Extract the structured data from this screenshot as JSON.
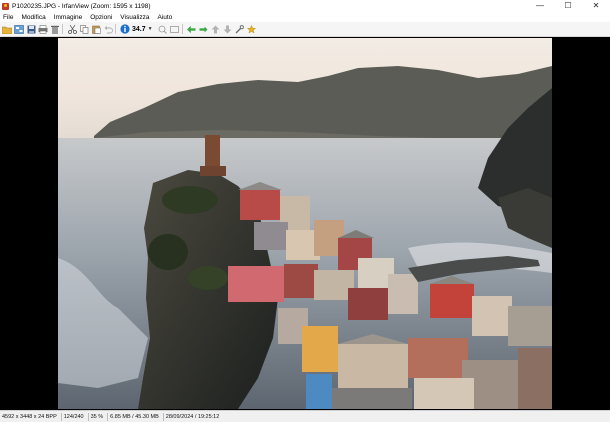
{
  "window": {
    "title": "P1020235.JPG - IrfanView (Zoom: 1595 x 1198)",
    "min_glyph": "—",
    "max_glyph": "☐",
    "close_glyph": "✕"
  },
  "menu": [
    "File",
    "Modifica",
    "Immagine",
    "Opzioni",
    "Visualizza",
    "Aiuto"
  ],
  "toolbar": {
    "icons": [
      "open-folder-icon",
      "thumbnails-icon",
      "save-icon",
      "print-icon",
      "delete-icon",
      "cut-icon",
      "copy-icon",
      "paste-icon",
      "undo-icon"
    ],
    "zoom_value": "34.7",
    "nav_icons": [
      "previous-icon",
      "next-icon",
      "first-icon",
      "last-icon",
      "scan-icon",
      "down-icon",
      "up-icon",
      "tools-icon",
      "favorite-icon"
    ]
  },
  "status": {
    "dimensions": "4592 x 3448 x 24 BPP",
    "index": "124/240",
    "zoom": "35 %",
    "size": "6.85 MB / 45.30 MB",
    "datetime": "28/09/2024 / 19:25:12"
  },
  "colors": {
    "accent_green": "#3aa845",
    "info_blue": "#1e6fd0"
  }
}
